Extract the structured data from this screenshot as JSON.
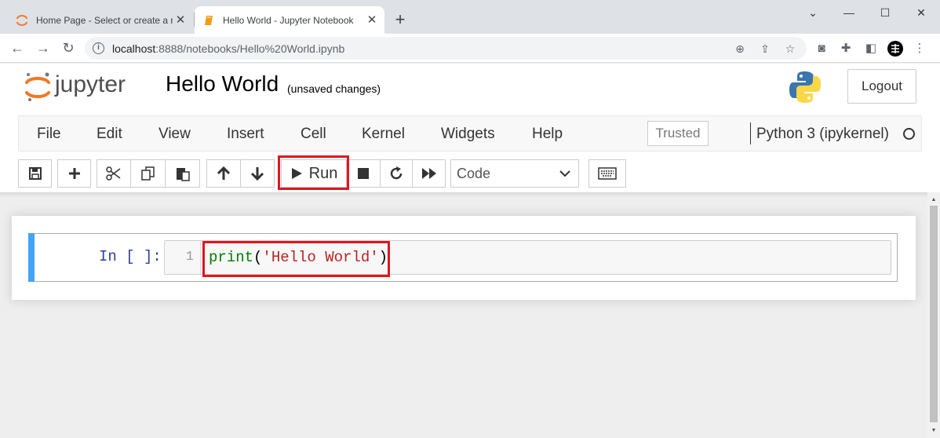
{
  "browser": {
    "tabs": [
      {
        "title": "Home Page - Select or create a notebook",
        "active": false
      },
      {
        "title": "Hello World - Jupyter Notebook",
        "active": true
      }
    ],
    "url_host": "localhost",
    "url_rest": ":8888/notebooks/Hello%20World.ipynb"
  },
  "jupyter": {
    "brand": "jupyter",
    "notebook_title": "Hello World",
    "autosave_status": "(unsaved changes)",
    "logout_label": "Logout",
    "menu": [
      "File",
      "Edit",
      "View",
      "Insert",
      "Cell",
      "Kernel",
      "Widgets",
      "Help"
    ],
    "trusted_label": "Trusted",
    "kernel_name": "Python 3 (ipykernel)",
    "toolbar": {
      "run_label": "Run",
      "cell_type": "Code"
    }
  },
  "cell": {
    "prompt": "In [ ]:",
    "line_number": "1",
    "code_builtin": "print",
    "code_open": "(",
    "code_string": "'Hello World'",
    "code_close": ")"
  },
  "colors": {
    "highlight": "#e0161f",
    "cell_selected": "#42a5f5",
    "jupyter_orange": "#f37726"
  }
}
